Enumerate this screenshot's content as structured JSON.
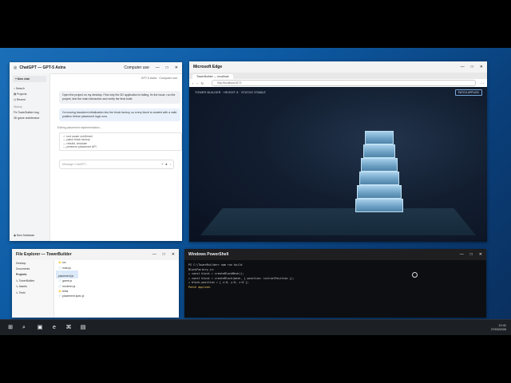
{
  "chat": {
    "title": "ChatGPT — GPT-5 Astra",
    "mode": "Computer use",
    "controls": [
      "—",
      "□",
      "✕"
    ],
    "new_chat": "+ New chat",
    "nav": [
      "Search",
      "Projects",
      "Recent"
    ],
    "section_header": "History",
    "history": [
      "Fix TowerBuilder bug",
      "3D game architecture"
    ],
    "footer": "New Database",
    "model_label": "GPT-5 Astra · Computer use",
    "user_message": "Open the project on my desktop. Find why the 3D application is failing, fix the issue, run the project, test the main interaction and verify the final build.",
    "assistant_message": "I'm moving transform initialization into the block factory, so every block is created with a valid position before placement logic runs.",
    "status": "Editing placement implementation...",
    "todo": [
      "✓ root cause confirmed",
      "— patch block factory",
      "— rebuild, simulate",
      "— preserve placement API"
    ],
    "composer_placeholder": "Message ChatGPT...",
    "composer_icons": [
      "+",
      "⏹",
      "↑"
    ]
  },
  "edge": {
    "title": "Microsoft Edge",
    "controls": [
      "—",
      "□",
      "✕"
    ],
    "tab": "TowerBuilder — localhost",
    "url": "http://localhost:5173",
    "nav": [
      "‹",
      "›",
      "↻"
    ],
    "hud": "TOWER BUILDER · HEIGHT 6 · STATUS STABLE",
    "badge": "PATCH APPLIED"
  },
  "tower_blocks": [
    1,
    2,
    3,
    4,
    5,
    6
  ],
  "files": {
    "title": "File Explorer — TowerBuilder",
    "controls": [
      "—",
      "□",
      "✕"
    ],
    "sidebar": [
      "Desktop",
      "Documents",
      "Projects",
      "↳ TowerBuilder",
      "↳ Assets",
      "↳ Tests"
    ],
    "items": [
      "📁 src",
      "📄 main.js",
      "📄 placement.js",
      "📄 game.js",
      "📄 renderer.js",
      "📁 tests",
      "📄 placement.spec.js"
    ]
  },
  "ps": {
    "title": "Windows PowerShell",
    "controls": [
      "—",
      "□",
      "✕"
    ],
    "lines": [
      "PS C:\\TowerBuilder> npm run build",
      "BlockFactory.js:",
      "+ const block = createBlockMesh();",
      "+ const block = createBlock(mesh, { position: initialPosition });",
      "+ block.position = { x:0, y:0, z:0 };",
      "Patch applied."
    ]
  },
  "taskbar": {
    "icons": [
      "⊞",
      "⌕",
      "▣",
      "e",
      "⌘",
      "▤"
    ],
    "time": "12:41",
    "date": "27/03/2026"
  }
}
